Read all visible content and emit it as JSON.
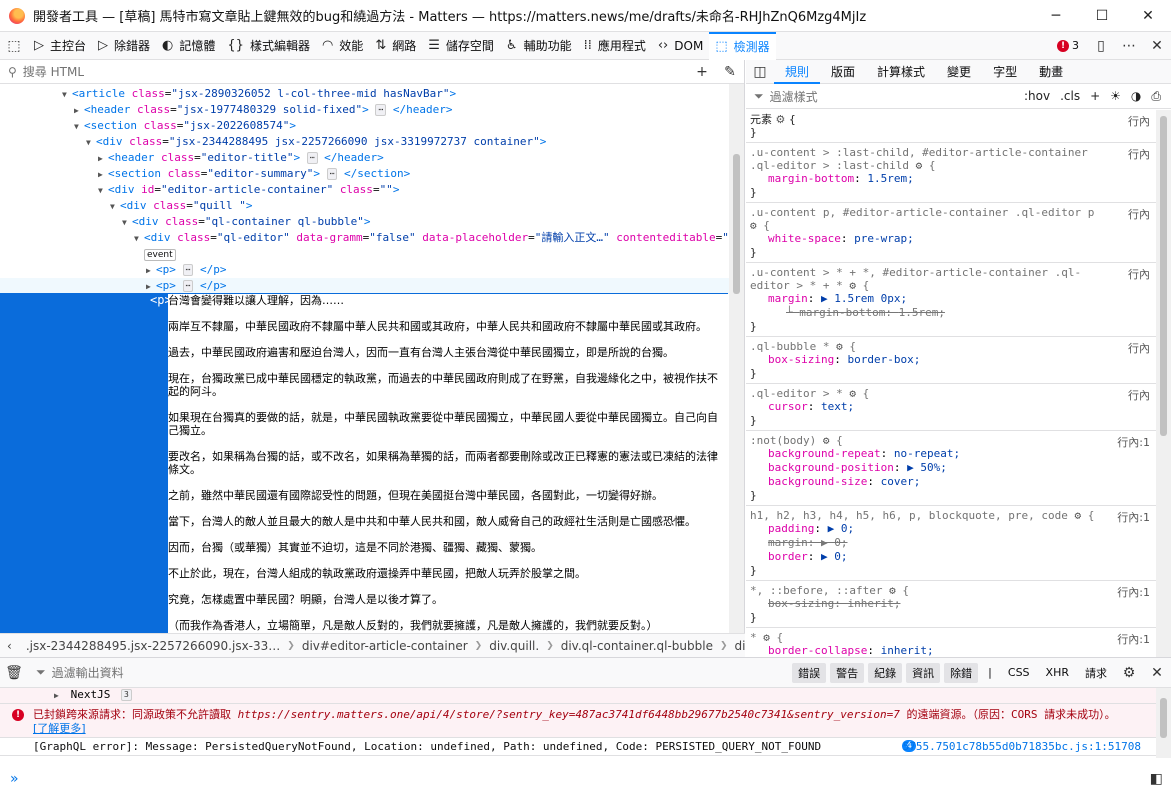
{
  "window": {
    "title": "開發者工具 — [草稿] 馬特市寫文章貼上鍵無效的bug和繞過方法 - Matters — https://matters.news/me/drafts/未命名-RHJhZnQ6Mzg4MjIz",
    "minimize": "─",
    "maximize": "☐",
    "close": "✕"
  },
  "toolbar": {
    "tools": [
      {
        "icon": "▷",
        "label": "主控台"
      },
      {
        "icon": "▷",
        "label": "除錯器"
      },
      {
        "icon": "◐",
        "label": "記憶體"
      },
      {
        "icon": "{}",
        "label": "樣式編輯器"
      },
      {
        "icon": "◠",
        "label": "效能"
      },
      {
        "icon": "⇅",
        "label": "網路"
      },
      {
        "icon": "☰",
        "label": "儲存空間"
      },
      {
        "icon": "♿",
        "label": "輔助功能"
      },
      {
        "icon": "⁞⁞",
        "label": "應用程式"
      },
      {
        "icon": "‹›",
        "label": "DOM"
      },
      {
        "icon": "⬚",
        "label": "檢測器"
      }
    ],
    "error_count": "3"
  },
  "markup": {
    "search_placeholder": "搜尋 HTML",
    "tree": [
      {
        "indent": 62,
        "tw": "▼",
        "html": [
          "article",
          "class",
          "jsx-2890326052 l-col-three-mid hasNavBar"
        ]
      },
      {
        "indent": 74,
        "tw": "▶",
        "html": [
          "header",
          "class",
          "jsx-1977480329 solid-fixed"
        ],
        "collapsed": "header"
      },
      {
        "indent": 74,
        "tw": "▼",
        "html": [
          "section",
          "class",
          "jsx-2022608574"
        ]
      },
      {
        "indent": 86,
        "tw": "▼",
        "html": [
          "div",
          "class",
          "jsx-2344288495 jsx-2257266090 jsx-3319972737 container"
        ]
      },
      {
        "indent": 98,
        "tw": "▶",
        "html": [
          "header",
          "class",
          "editor-title"
        ],
        "collapsed": "header"
      },
      {
        "indent": 98,
        "tw": "▶",
        "html": [
          "section",
          "class",
          "editor-summary"
        ],
        "collapsed": "section"
      },
      {
        "indent": 98,
        "tw": "▼",
        "html": [
          "div",
          "id",
          "editor-article-container",
          "class",
          ""
        ]
      },
      {
        "indent": 110,
        "tw": "▼",
        "html": [
          "div",
          "class",
          "quill "
        ]
      },
      {
        "indent": 122,
        "tw": "▼",
        "html": [
          "div",
          "class",
          "ql-container ql-bubble"
        ]
      },
      {
        "indent": 134,
        "tw": "▼",
        "html": [
          "div",
          "class",
          "ql-editor",
          "data-gramm",
          "false",
          "data-placeholder",
          "請輸入正文…",
          "contenteditable",
          "true"
        ]
      },
      {
        "event": "event"
      },
      {
        "indent": 146,
        "tw": "▶",
        "p": true
      },
      {
        "indent": 146,
        "tw": "▶",
        "p": true,
        "hl": true
      }
    ],
    "selected_tag": "<p>",
    "selected_paragraphs": [
      "台灣會變得難以讓人理解，因為……",
      "兩岸互不隸屬，中華民國政府不隸屬中華人民共和國或其政府，中華人民共和國政府不隸屬中華民國或其政府。",
      "過去，中華民國政府遍害和壓迫台灣人，因而一直有台灣人主張台灣從中華民國獨立，即是所說的台獨。",
      "現在，台獨政黨已成中華民國穩定的執政黨，而過去的中華民國政府則成了在野黨，自我邊緣化之中，被視作扶不起的阿斗。",
      "如果現在台獨真的要做的話，就是，中華民國執政黨要從中華民國獨立，中華民國人要從中華民國獨立。自己向自己獨立。",
      "要改名，如果稱為台獨的話，或不改名，如果稱為華獨的話，而兩者都要刪除或改正已釋憲的憲法或已凍結的法律條文。",
      "之前，雖然中華民國還有國際認受性的問題，但現在美國挺台灣中華民國，各國對此，一切變得好辦。",
      "當下，台灣人的敵人並且最大的敵人是中共和中華人民共和國，敵人威脅自己的政經社生活則是亡國感恐懼。",
      "因而，台獨（或華獨）其實並不迫切，這是不同於港獨、疆獨、藏獨、蒙獨。",
      "不止於此，現在，台灣人組成的執政黨政府還操弄中華民國，把敵人玩弄於股掌之間。",
      "究竟，怎樣處置中華民國？明顯，台灣人是以後才算了。",
      "（而我作為香港人，立場簡單，凡是敵人反對的，我們就要擁護，凡是敵人擁護的，我們就要反對。）"
    ],
    "breadcrumbs": [
      ".jsx-2344288495.jsx-2257266090.jsx-33…",
      "div#editor-article-container",
      "div.quill.",
      "div.ql-container.ql-bubble",
      "div.ql-editor",
      "p"
    ]
  },
  "sidebar": {
    "tabs": [
      "規則",
      "版面",
      "計算樣式",
      "變更",
      "字型",
      "動畫"
    ],
    "filter_placeholder": "過濾樣式",
    "hov": ":hov",
    "cls": ".cls",
    "rules": [
      {
        "selector": "元素",
        "first": true,
        "src": "行內",
        "decls": []
      },
      {
        "selector": ".u-content > :last-child, #editor-article-container .ql-editor > :last-child",
        "src": "行內",
        "decls": [
          {
            "p": "margin-bottom",
            "v": "1.5rem;"
          }
        ]
      },
      {
        "selector": ".u-content p, #editor-article-container .ql-editor p",
        "src": "行內",
        "decls": [
          {
            "p": "white-space",
            "v": "pre-wrap;"
          }
        ]
      },
      {
        "selector": ".u-content > * + *, #editor-article-container .ql-editor > * + *",
        "src": "行內",
        "decls": [
          {
            "p": "margin",
            "v": "▶ 1.5rem 0px;"
          },
          {
            "p": "margin-bottom",
            "v": "1.5rem;",
            "over": true,
            "sub": true
          }
        ]
      },
      {
        "selector": ".ql-bubble *",
        "src": "行內",
        "decls": [
          {
            "p": "box-sizing",
            "v": "border-box;"
          }
        ]
      },
      {
        "selector": ".ql-editor > *",
        "src": "行內",
        "decls": [
          {
            "p": "cursor",
            "v": "text;"
          }
        ]
      },
      {
        "selector": ":not(body)",
        "src": "行內:1",
        "decls": [
          {
            "p": "background-repeat",
            "v": "no-repeat;"
          },
          {
            "p": "background-position",
            "v": "▶ 50%;"
          },
          {
            "p": "background-size",
            "v": "cover;"
          }
        ]
      },
      {
        "selector": "h1, h2, h3, h4, h5, h6, p, blockquote, pre, code",
        "src": "行內:1",
        "decls": [
          {
            "p": "padding",
            "v": "▶ 0;"
          },
          {
            "p": "margin",
            "v": "▶ 0;",
            "over": true
          },
          {
            "p": "border",
            "v": "▶ 0;"
          }
        ]
      },
      {
        "selector": "*, ::before, ::after",
        "src": "行內:1",
        "decls": [
          {
            "p": "box-sizing",
            "v": "inherit;",
            "over": true
          }
        ]
      },
      {
        "selector": "*",
        "src": "行內:1",
        "decls": [
          {
            "p": "border-collapse",
            "v": "inherit;"
          }
        ]
      }
    ]
  },
  "console": {
    "filter_placeholder": "過濾輸出資料",
    "filters": [
      "錯誤",
      "警告",
      "紀錄",
      "資訊",
      "除錯"
    ],
    "extra_filters": [
      "CSS",
      "XHR",
      "請求"
    ],
    "group_label": "NextJS",
    "group_count": "3",
    "error_prefix": "已封鎖跨來源請求：同源政策不允許讀取 ",
    "error_url": "https://sentry.matters.one/api/4/store/?sentry_key=487ac3741df6448bb29677b2540c7341&sentry_version=7",
    "error_suffix": " 的遠端資源。（原因：CORS 請求未成功）。",
    "error_link": "[了解更多]",
    "log_text": "[GraphQL error]: Message: PersistedQueryNotFound, Location: undefined, Path: undefined, Code: PERSISTED_QUERY_NOT_FOUND",
    "log_count": "4",
    "log_location": "5755.7501c78b55d0b71835bc.js:1:51708",
    "prompt": "»"
  }
}
